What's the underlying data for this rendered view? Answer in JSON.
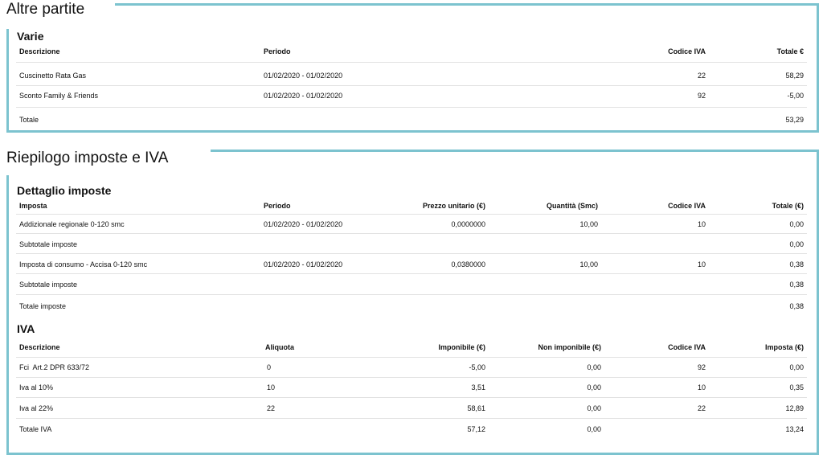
{
  "altre_partite": {
    "title": "Altre partite",
    "subtitle": "Varie",
    "headers": {
      "descrizione": "Descrizione",
      "periodo": "Periodo",
      "codice_iva": "Codice IVA",
      "totale": "Totale €"
    },
    "rows": [
      {
        "descrizione": "Cuscinetto Rata Gas",
        "periodo": "01/02/2020 - 01/02/2020",
        "codice_iva": "22",
        "totale": "58,29"
      },
      {
        "descrizione": "Sconto Family & Friends",
        "periodo": "01/02/2020 - 01/02/2020",
        "codice_iva": "92",
        "totale": "-5,00"
      }
    ],
    "total": {
      "label": "Totale",
      "value": "53,29"
    }
  },
  "riepilogo": {
    "title": "Riepilogo imposte e IVA",
    "dettaglio": {
      "title": "Dettaglio imposte",
      "headers": {
        "imposta": "Imposta",
        "periodo": "Periodo",
        "prezzo": "Prezzo unitario (€)",
        "quantita": "Quantità (Smc)",
        "codice_iva": "Codice IVA",
        "totale": "Totale (€)"
      },
      "rows": [
        {
          "imposta": "Addizionale regionale 0-120 smc",
          "periodo": "01/02/2020 - 01/02/2020",
          "prezzo": "0,0000000",
          "quantita": "10,00",
          "codice_iva": "10",
          "totale": "0,00"
        },
        {
          "subtotal_label": "Subtotale imposte",
          "subtotal_value": "0,00"
        },
        {
          "imposta": "Imposta di consumo - Accisa 0-120 smc",
          "periodo": "01/02/2020 - 01/02/2020",
          "prezzo": "0,0380000",
          "quantita": "10,00",
          "codice_iva": "10",
          "totale": "0,38"
        },
        {
          "subtotal_label": "Subtotale imposte",
          "subtotal_value": "0,38"
        }
      ],
      "total": {
        "label": "Totale imposte",
        "value": "0,38"
      }
    },
    "iva": {
      "title": "IVA",
      "headers": {
        "descrizione": "Descrizione",
        "aliquota": "Aliquota",
        "imponibile": "Imponibile (€)",
        "non_imponibile": "Non imponibile (€)",
        "codice_iva": "Codice IVA",
        "imposta": "Imposta (€)"
      },
      "rows": [
        {
          "descrizione": "Fci  Art.2 DPR 633/72",
          "aliquota": "0",
          "imponibile": "-5,00",
          "non_imponibile": "0,00",
          "codice_iva": "92",
          "imposta": "0,00"
        },
        {
          "descrizione": "Iva al 10%",
          "aliquota": "10",
          "imponibile": "3,51",
          "non_imponibile": "0,00",
          "codice_iva": "10",
          "imposta": "0,35"
        },
        {
          "descrizione": "Iva al 22%",
          "aliquota": "22",
          "imponibile": "58,61",
          "non_imponibile": "0,00",
          "codice_iva": "22",
          "imposta": "12,89"
        }
      ],
      "total": {
        "label": "Totale IVA",
        "imponibile": "57,12",
        "non_imponibile": "0,00",
        "imposta": "13,24"
      }
    }
  },
  "colors": {
    "accent": "#7cc3cf",
    "separator": "#e2e2e2"
  }
}
